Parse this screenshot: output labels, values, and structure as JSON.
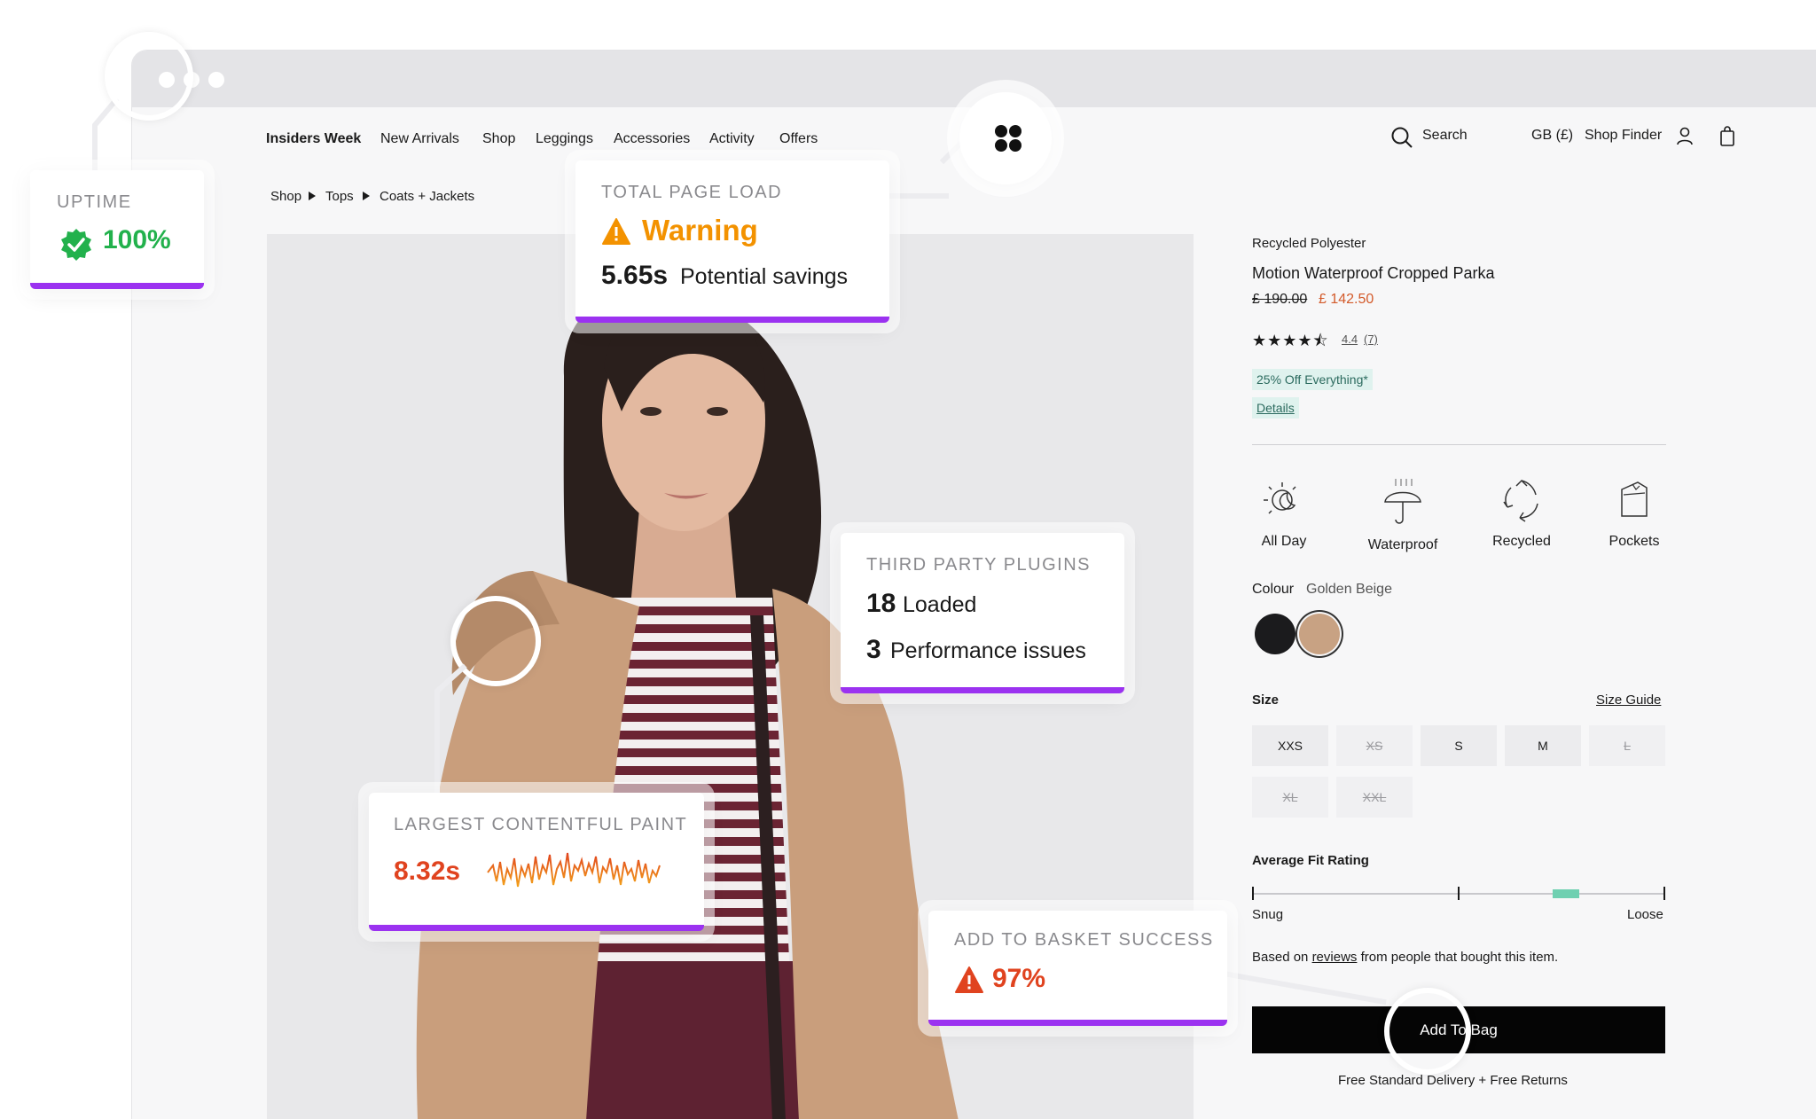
{
  "nav": {
    "items": [
      "Insiders Week",
      "New Arrivals",
      "Shop",
      "Leggings",
      "Accessories",
      "Activity",
      "Offers"
    ],
    "search_label": "Search",
    "region": "GB (£)",
    "shop_finder": "Shop Finder"
  },
  "breadcrumb": [
    "Shop",
    "Tops",
    "Coats + Jackets"
  ],
  "product": {
    "material": "Recycled Polyester",
    "name": "Motion Waterproof Cropped Parka",
    "price_old": "£ 190.00",
    "price_new": "£ 142.50",
    "rating_value": "4.4",
    "rating_count": "(7)",
    "rating_stars": 4.4,
    "promo": "25% Off Everything*",
    "details_link": "Details",
    "features": [
      {
        "label": "All Day",
        "icon": "day-night-icon"
      },
      {
        "label": "Waterproof",
        "icon": "umbrella-icon"
      },
      {
        "label": "Recycled",
        "icon": "recycle-icon"
      },
      {
        "label": "Pockets",
        "icon": "pocket-icon"
      }
    ],
    "colour_label": "Colour",
    "colour_value": "Golden Beige",
    "swatches": [
      "#1b1b1d",
      "#c8a283"
    ],
    "size_label": "Size",
    "size_guide": "Size Guide",
    "sizes": [
      {
        "label": "XXS",
        "available": true
      },
      {
        "label": "XS",
        "available": false
      },
      {
        "label": "S",
        "available": true
      },
      {
        "label": "M",
        "available": true
      },
      {
        "label": "L",
        "available": false
      },
      {
        "label": "XL",
        "available": false
      },
      {
        "label": "XXL",
        "available": false
      }
    ],
    "fit_title": "Average Fit Rating",
    "fit_snug": "Snug",
    "fit_loose": "Loose",
    "fit_value": 0.76,
    "based_on_pre": "Based on ",
    "based_on_link": "reviews",
    "based_on_post": " from people that bought this item.",
    "add_to_bag": "Add To Bag",
    "delivery": "Free Standard Delivery + Free Returns"
  },
  "cards": {
    "uptime": {
      "label": "UPTIME",
      "value": "100%"
    },
    "page_load": {
      "label": "TOTAL PAGE LOAD",
      "status": "Warning",
      "time": "5.65s",
      "time_text": "Potential savings"
    },
    "plugins": {
      "label": "THIRD PARTY PLUGINS",
      "loaded_count": "18",
      "loaded_text": "Loaded",
      "issues_count": "3",
      "issues_text": "Performance issues"
    },
    "lcp": {
      "label": "LARGEST CONTENTFUL PAINT",
      "value": "8.32s"
    },
    "basket": {
      "label": "ADD TO BASKET SUCCESS",
      "value": "97%"
    }
  },
  "colors": {
    "accent_purple": "#9b32f0",
    "success_green": "#22b14c",
    "warning_orange": "#f39200",
    "danger_red": "#e0431f",
    "sale_orange": "#d35a2a"
  }
}
